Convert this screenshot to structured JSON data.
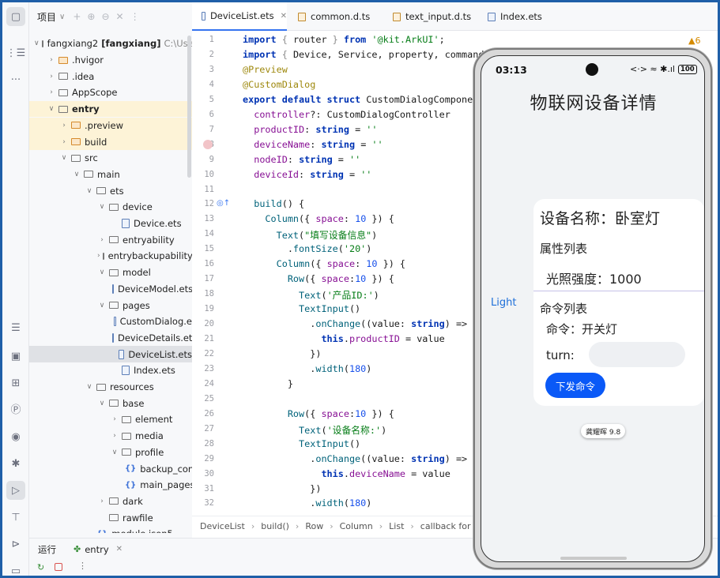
{
  "project": {
    "header": "项目",
    "tree": [
      {
        "label": "fangxiang2",
        "bold_suffix": "[fangxiang]",
        "gray": "C:\\Users\\",
        "indent": 0,
        "chevron": "v",
        "icon": "folder"
      },
      {
        "label": ".hvigor",
        "indent": 1,
        "chevron": ">",
        "icon": "folder-orange"
      },
      {
        "label": ".idea",
        "indent": 1,
        "chevron": ">",
        "icon": "folder"
      },
      {
        "label": "AppScope",
        "indent": 1,
        "chevron": ">",
        "icon": "folder"
      },
      {
        "label": "entry",
        "indent": 1,
        "chevron": "v",
        "icon": "folder",
        "bold": true
      },
      {
        "label": ".preview",
        "indent": 2,
        "chevron": ">",
        "icon": "folder-orange"
      },
      {
        "label": "build",
        "indent": 2,
        "chevron": ">",
        "icon": "folder-orange"
      },
      {
        "label": "src",
        "indent": 2,
        "chevron": "v",
        "icon": "folder"
      },
      {
        "label": "main",
        "indent": 3,
        "chevron": "v",
        "icon": "folder"
      },
      {
        "label": "ets",
        "indent": 4,
        "chevron": "v",
        "icon": "folder"
      },
      {
        "label": "device",
        "indent": 5,
        "chevron": "v",
        "icon": "folder"
      },
      {
        "label": "Device.ets",
        "indent": 6,
        "chevron": "",
        "icon": "file"
      },
      {
        "label": "entryability",
        "indent": 5,
        "chevron": ">",
        "icon": "folder"
      },
      {
        "label": "entrybackupability",
        "indent": 5,
        "chevron": ">",
        "icon": "folder"
      },
      {
        "label": "model",
        "indent": 5,
        "chevron": "v",
        "icon": "folder"
      },
      {
        "label": "DeviceModel.ets",
        "indent": 6,
        "chevron": "",
        "icon": "file"
      },
      {
        "label": "pages",
        "indent": 5,
        "chevron": "v",
        "icon": "folder"
      },
      {
        "label": "CustomDialog.e",
        "indent": 6,
        "chevron": "",
        "icon": "file"
      },
      {
        "label": "DeviceDetails.et",
        "indent": 6,
        "chevron": "",
        "icon": "file"
      },
      {
        "label": "DeviceList.ets",
        "indent": 6,
        "chevron": "",
        "icon": "file",
        "selected": true
      },
      {
        "label": "Index.ets",
        "indent": 6,
        "chevron": "",
        "icon": "file"
      },
      {
        "label": "resources",
        "indent": 4,
        "chevron": "v",
        "icon": "folder"
      },
      {
        "label": "base",
        "indent": 5,
        "chevron": "v",
        "icon": "folder"
      },
      {
        "label": "element",
        "indent": 6,
        "chevron": ">",
        "icon": "folder"
      },
      {
        "label": "media",
        "indent": 6,
        "chevron": ">",
        "icon": "folder"
      },
      {
        "label": "profile",
        "indent": 6,
        "chevron": "v",
        "icon": "folder"
      },
      {
        "label": "backup_conf",
        "indent": 7,
        "chevron": "",
        "icon": "json"
      },
      {
        "label": "main_pages.",
        "indent": 7,
        "chevron": "",
        "icon": "json"
      },
      {
        "label": "dark",
        "indent": 5,
        "chevron": ">",
        "icon": "folder"
      },
      {
        "label": "rawfile",
        "indent": 5,
        "chevron": "",
        "icon": "folder"
      },
      {
        "label": "module.json5",
        "indent": 4,
        "chevron": "",
        "icon": "json"
      }
    ]
  },
  "tabs": [
    {
      "label": "DeviceList.ets",
      "active": true,
      "closable": true
    },
    {
      "label": "common.d.ts",
      "active": false,
      "closable": false
    },
    {
      "label": "text_input.d.ts",
      "active": false,
      "closable": false
    },
    {
      "label": "Index.ets",
      "active": false,
      "closable": false
    }
  ],
  "editor": {
    "warnings": "▲6",
    "line_numbers": [
      "1",
      "2",
      "3",
      "4",
      "5",
      "6",
      "7",
      "8",
      "9",
      "10",
      "11",
      "12",
      "13",
      "14",
      "15",
      "16",
      "17",
      "18",
      "19",
      "20",
      "21",
      "22",
      "23",
      "24",
      "25",
      "26",
      "27",
      "28",
      "29",
      "30",
      "31",
      "32"
    ],
    "code": [
      [
        [
          "kw",
          "import"
        ],
        [
          "brk",
          " { "
        ],
        [
          "id",
          "router"
        ],
        [
          "brk",
          " } "
        ],
        [
          "kw",
          "from"
        ],
        [
          "str",
          " '@kit.ArkUI'"
        ],
        [
          "id",
          ";"
        ]
      ],
      [
        [
          "kw",
          "import"
        ],
        [
          "brk",
          " { "
        ],
        [
          "id",
          "Device, Service, property, command"
        ]
      ],
      [
        [
          "dec",
          "@Preview"
        ]
      ],
      [
        [
          "dec",
          "@CustomDialog"
        ]
      ],
      [
        [
          "kw",
          "export default struct "
        ],
        [
          "id",
          "CustomDialogComponent"
        ]
      ],
      [
        [
          "id",
          "  "
        ],
        [
          "prop",
          "controller"
        ],
        [
          "id",
          "?: "
        ],
        [
          "id",
          "CustomDialogController"
        ]
      ],
      [
        [
          "id",
          "  "
        ],
        [
          "prop",
          "productID"
        ],
        [
          "id",
          ": "
        ],
        [
          "kw",
          "string"
        ],
        [
          "id",
          " = "
        ],
        [
          "str",
          "''"
        ]
      ],
      [
        [
          "id",
          "  "
        ],
        [
          "prop",
          "deviceName"
        ],
        [
          "id",
          ": "
        ],
        [
          "kw",
          "string"
        ],
        [
          "id",
          " = "
        ],
        [
          "str",
          "''"
        ]
      ],
      [
        [
          "id",
          "  "
        ],
        [
          "prop",
          "nodeID"
        ],
        [
          "id",
          ": "
        ],
        [
          "kw",
          "string"
        ],
        [
          "id",
          " = "
        ],
        [
          "str",
          "''"
        ]
      ],
      [
        [
          "id",
          "  "
        ],
        [
          "prop",
          "deviceId"
        ],
        [
          "id",
          ": "
        ],
        [
          "kw",
          "string"
        ],
        [
          "id",
          " = "
        ],
        [
          "str",
          "''"
        ]
      ],
      [
        [
          "id",
          ""
        ]
      ],
      [
        [
          "id",
          "  "
        ],
        [
          "fn",
          "build"
        ],
        [
          "id",
          "() {"
        ]
      ],
      [
        [
          "id",
          "    "
        ],
        [
          "fn",
          "Column"
        ],
        [
          "id",
          "({ "
        ],
        [
          "prop",
          "space"
        ],
        [
          "id",
          ": "
        ],
        [
          "num",
          "10"
        ],
        [
          "id",
          " }) {"
        ]
      ],
      [
        [
          "id",
          "      "
        ],
        [
          "fn",
          "Text"
        ],
        [
          "id",
          "("
        ],
        [
          "str",
          "\"填写设备信息\""
        ],
        [
          "id",
          ")"
        ]
      ],
      [
        [
          "id",
          "        ."
        ],
        [
          "fn",
          "fontSize"
        ],
        [
          "id",
          "("
        ],
        [
          "str",
          "'20'"
        ],
        [
          "id",
          ")"
        ]
      ],
      [
        [
          "id",
          "      "
        ],
        [
          "fn",
          "Column"
        ],
        [
          "id",
          "({ "
        ],
        [
          "prop",
          "space"
        ],
        [
          "id",
          ": "
        ],
        [
          "num",
          "10"
        ],
        [
          "id",
          " }) {"
        ]
      ],
      [
        [
          "id",
          "        "
        ],
        [
          "fn",
          "Row"
        ],
        [
          "id",
          "({ "
        ],
        [
          "prop",
          "space"
        ],
        [
          "id",
          ":"
        ],
        [
          "num",
          "10"
        ],
        [
          "id",
          " }) {"
        ]
      ],
      [
        [
          "id",
          "          "
        ],
        [
          "fn",
          "Text"
        ],
        [
          "id",
          "("
        ],
        [
          "str",
          "'产品ID:'"
        ],
        [
          "id",
          ")"
        ]
      ],
      [
        [
          "id",
          "          "
        ],
        [
          "fn",
          "TextInput"
        ],
        [
          "id",
          "()"
        ]
      ],
      [
        [
          "id",
          "            ."
        ],
        [
          "fn",
          "onChange"
        ],
        [
          "id",
          "(("
        ],
        [
          "id",
          "value"
        ],
        [
          "id",
          ": "
        ],
        [
          "kw",
          "string"
        ],
        [
          "id",
          ") => {"
        ]
      ],
      [
        [
          "id",
          "              "
        ],
        [
          "kw",
          "this"
        ],
        [
          "id",
          "."
        ],
        [
          "prop",
          "productID"
        ],
        [
          "id",
          " = value"
        ]
      ],
      [
        [
          "id",
          "            })"
        ]
      ],
      [
        [
          "id",
          "            ."
        ],
        [
          "fn",
          "width"
        ],
        [
          "id",
          "("
        ],
        [
          "num",
          "180"
        ],
        [
          "id",
          ")"
        ]
      ],
      [
        [
          "id",
          "        }"
        ]
      ],
      [
        [
          "id",
          ""
        ]
      ],
      [
        [
          "id",
          "        "
        ],
        [
          "fn",
          "Row"
        ],
        [
          "id",
          "({ "
        ],
        [
          "prop",
          "space"
        ],
        [
          "id",
          ":"
        ],
        [
          "num",
          "10"
        ],
        [
          "id",
          " }) {"
        ]
      ],
      [
        [
          "id",
          "          "
        ],
        [
          "fn",
          "Text"
        ],
        [
          "id",
          "("
        ],
        [
          "str",
          "'设备名称:'"
        ],
        [
          "id",
          ")"
        ]
      ],
      [
        [
          "id",
          "          "
        ],
        [
          "fn",
          "TextInput"
        ],
        [
          "id",
          "()"
        ]
      ],
      [
        [
          "id",
          "            ."
        ],
        [
          "fn",
          "onChange"
        ],
        [
          "id",
          "(("
        ],
        [
          "id",
          "value"
        ],
        [
          "id",
          ": "
        ],
        [
          "kw",
          "string"
        ],
        [
          "id",
          ") => {"
        ]
      ],
      [
        [
          "id",
          "              "
        ],
        [
          "kw",
          "this"
        ],
        [
          "id",
          "."
        ],
        [
          "prop",
          "deviceName"
        ],
        [
          "id",
          " = value"
        ]
      ],
      [
        [
          "id",
          "            })"
        ]
      ],
      [
        [
          "id",
          "            ."
        ],
        [
          "fn",
          "width"
        ],
        [
          "id",
          "("
        ],
        [
          "num",
          "180"
        ],
        [
          "id",
          ")"
        ]
      ]
    ],
    "breadcrumb": [
      "DeviceList",
      "build()",
      "Row",
      "Column",
      "List",
      "callback for ForE"
    ]
  },
  "run": {
    "label": "运行",
    "tab": "entry"
  },
  "phone": {
    "time": "03:13",
    "status_icons": "<·> ≈ ✱.ıl",
    "battery": "100",
    "page_title": "物联网设备详情",
    "side_label": "Light",
    "device_name": "设备名称：卧室灯",
    "property_title": "属性列表",
    "property_item": "光照强度：1000",
    "command_title": "命令列表",
    "command_item": "命令：开关灯",
    "turn_label": "turn:",
    "send_button": "下发命令",
    "toast": "龚耀晖 9.8"
  },
  "colors": {
    "accent": "#0a59f7",
    "frame": "#1f5fa8",
    "keyword": "#0033b3",
    "string": "#067d17"
  }
}
